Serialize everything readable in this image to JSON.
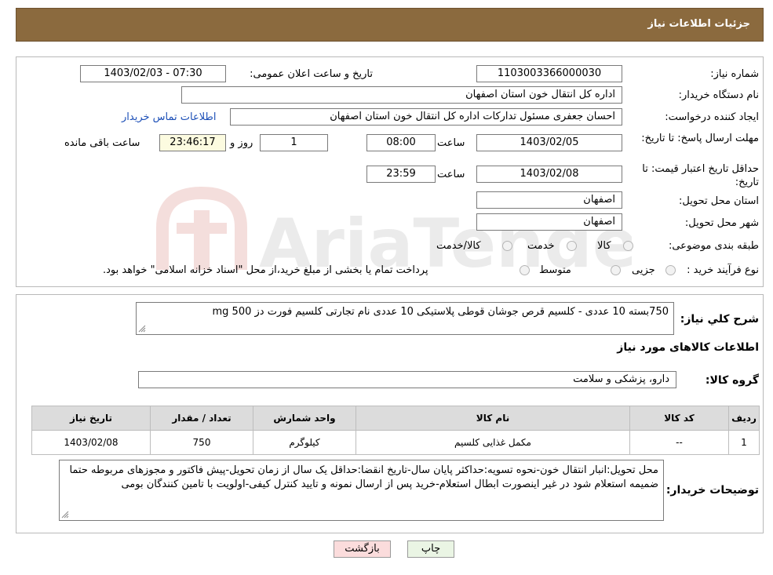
{
  "header": {
    "title": "جزئیات اطلاعات نیاز"
  },
  "form": {
    "need_number_label": "شماره نیاز:",
    "need_number": "1103003366000030",
    "announce_label": "تاریخ و ساعت اعلان عمومی:",
    "announce_value": "1403/02/03 - 07:30",
    "buyer_org_label": "نام دستگاه خریدار:",
    "buyer_org": "اداره کل انتقال خون استان اصفهان",
    "creator_label": "ایجاد کننده درخواست:",
    "creator": "احسان جعفری مسئول تدارکات اداره کل انتقال خون استان اصفهان",
    "contact_link": "اطلاعات تماس خریدار",
    "reply_deadline_label": "مهلت ارسال پاسخ: تا تاریخ:",
    "reply_date": "1403/02/05",
    "time_label": "ساعت",
    "reply_time": "08:00",
    "days": "1",
    "day_and_label": "روز و",
    "remaining_time": "23:46:17",
    "remaining_label": "ساعت باقی مانده",
    "price_validity_label": "حداقل تاریخ اعتبار قیمت: تا تاریخ:",
    "price_date": "1403/02/08",
    "price_time": "23:59",
    "delivery_province_label": "استان محل تحویل:",
    "delivery_province": "اصفهان",
    "delivery_city_label": "شهر محل تحویل:",
    "delivery_city": "اصفهان",
    "category_label": "طبقه بندی موضوعی:",
    "category_options": [
      "کالا",
      "خدمت",
      "کالا/خدمت"
    ],
    "purchase_type_label": "نوع فرآیند خرید :",
    "purchase_options": [
      "جزیی",
      "متوسط"
    ],
    "payment_note": "پرداخت تمام یا بخشی از مبلغ خرید،از محل \"اسناد خزانه اسلامی\" خواهد بود."
  },
  "summary": {
    "label": "شرح کلي نياز:",
    "text": "750بسته 10 عددی - کلسیم قرص جوشان قوطی پلاستیکی 10 عددی نام تجارتی کلسیم فورت دز 500 mg",
    "goods_info_title": "اطلاعات کالاهای مورد نیاز",
    "group_label": "گروه کالا:",
    "group_value": "دارو، پزشکی و سلامت"
  },
  "table": {
    "headers": [
      "ردیف",
      "کد کالا",
      "نام کالا",
      "واحد شمارش",
      "تعداد / مقدار",
      "تاریخ نیاز"
    ],
    "rows": [
      [
        "1",
        "--",
        "مکمل غذایی کلسیم",
        "کیلوگرم",
        "750",
        "1403/02/08"
      ]
    ]
  },
  "buyer_notes": {
    "label": "توضیحات خریدار:",
    "text": "محل تحویل:انبار انتقال خون-نحوه تسویه:حداکثر پایان سال-تاریخ انقضا:حداقل یک سال از زمان تحویل-پیش فاکتور و مجوزهای مربوطه حتما ضمیمه استعلام شود در غیر اینصورت ابطال استعلام-خرید پس از ارسال نمونه و تایید کنترل کیفی-اولویت با تامین کنندگان بومی"
  },
  "buttons": {
    "print": "چاپ",
    "back": "بازگشت"
  },
  "colors": {
    "header_bg": "#8b6a3e",
    "link": "#1c4fb7",
    "back_button_bg": "#fbdcdc",
    "print_button_bg": "#eaf5e4"
  },
  "watermark": {
    "text": "AriaTender.neT"
  }
}
